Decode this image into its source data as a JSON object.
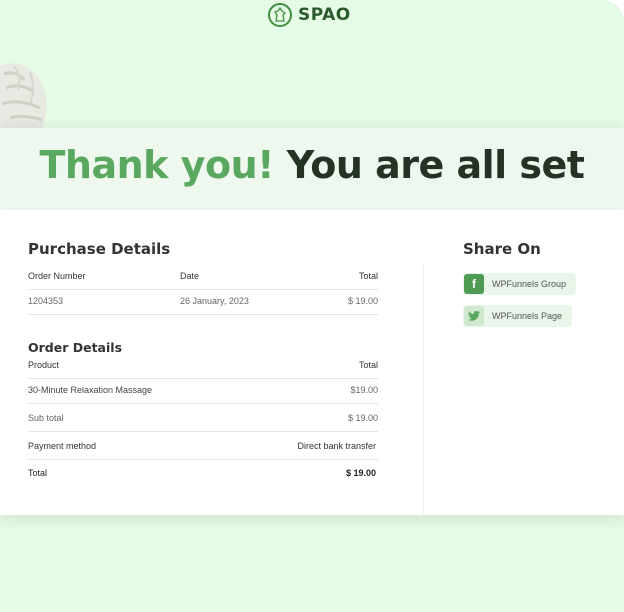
{
  "brand": {
    "name": "SPAO"
  },
  "hero": {
    "part1": "Thank you!",
    "part2": "You are all set"
  },
  "purchase": {
    "title": "Purchase Details",
    "headers": {
      "order_number": "Order Number",
      "date": "Date",
      "total": "Total"
    },
    "row": {
      "order_number": "1204353",
      "date": "26 January, 2023",
      "total": "$ 19.00"
    }
  },
  "order": {
    "title": "Order Details",
    "headers": {
      "product": "Product",
      "total": "Total"
    },
    "items": [
      {
        "name": "30-Minute Relaxation Massage",
        "price": "$19.00"
      }
    ],
    "subtotal": {
      "label": "Sub total",
      "value": "$ 19.00"
    },
    "payment": {
      "label": "Payment method",
      "value": "Direct bank transfer"
    },
    "total": {
      "label": "Total",
      "value": "$ 19.00"
    }
  },
  "share": {
    "title": "Share On",
    "links": [
      {
        "icon": "facebook-icon",
        "label": "WPFunnels Group",
        "color": "#4f9a52"
      },
      {
        "icon": "twitter-icon",
        "label": "WPFunnels Page",
        "color": "#7cc07f"
      }
    ]
  },
  "colors": {
    "accent": "#5aa85f",
    "dark": "#243326",
    "background": "#e6fbe6"
  }
}
